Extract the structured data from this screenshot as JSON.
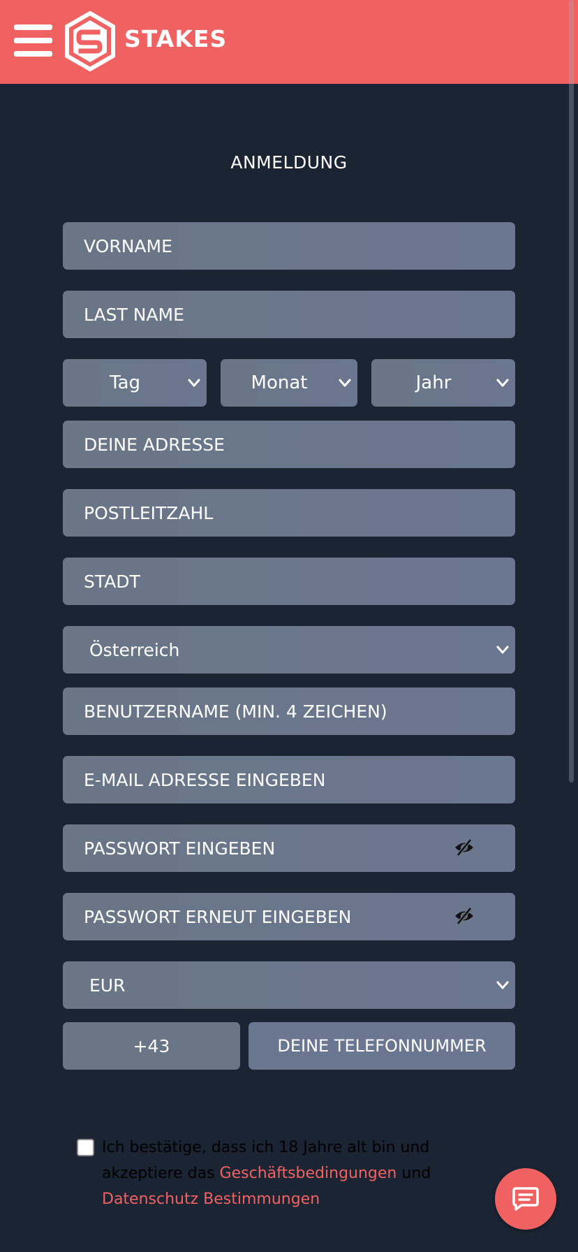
{
  "header": {
    "brand_name": "STAKES",
    "background_color": "#f06262",
    "icons": [
      "hamburger-menu-icon",
      "stakes-logo-icon"
    ]
  },
  "page": {
    "title": "ANMELDUNG",
    "background_color": "#1b2433"
  },
  "form": {
    "first_name_placeholder": "VORNAME",
    "last_name_placeholder": "LAST NAME",
    "dob": {
      "day": "Tag",
      "month": "Monat",
      "year": "Jahr"
    },
    "address_placeholder": "DEINE ADRESSE",
    "postal_code_placeholder": "POSTLEITZAHL",
    "city_placeholder": "STADT",
    "country_selected": "Österreich",
    "username_placeholder": "BENUTZERNAME (MIN. 4 ZEICHEN)",
    "email_placeholder": "E-MAIL ADRESSE EINGEBEN",
    "password_placeholder": "PASSWORT EINGEBEN",
    "password_repeat_placeholder": "PASSWORT ERNEUT EINGEBEN",
    "currency_selected": "EUR",
    "phone_code": "+43",
    "phone_placeholder": "DEINE TELEFONNUMMER"
  },
  "consent": {
    "text_part1": "Ich bestätige, dass ich 18 Jahre alt bin und akzeptiere das",
    "terms_link": "Geschäftsbedingungen",
    "connector": "und",
    "privacy_link": "Datenschutz Bestimmungen",
    "link_color": "#f06262"
  },
  "chat": {
    "icon": "chat-icon"
  }
}
